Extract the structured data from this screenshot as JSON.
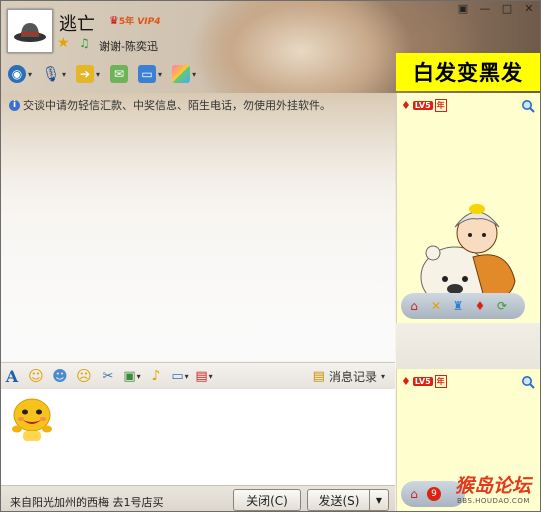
{
  "header": {
    "nickname": "逃亡",
    "vip_badge": "VIP4",
    "vip_years": "5年",
    "signature": "谢谢-陈奕迅",
    "window_buttons": [
      "▣",
      "—",
      "□",
      "✕"
    ]
  },
  "banner": {
    "text": "白发变黑发"
  },
  "chat": {
    "notice": "交谈中请勿轻信汇款、中奖信息、陌生电话，勿使用外挂软件。"
  },
  "input_toolbar": {
    "history_label": "消息记录"
  },
  "bottom": {
    "ad_text": "来自阳光加州的西梅 去1号店买",
    "close_label": "关闭(C)",
    "send_label": "发送(S)"
  },
  "right_panel": {
    "level": "LV5",
    "year_tag": "年",
    "badge_count": "9"
  },
  "watermark": {
    "logo": "猴岛论坛",
    "url": "BBS.HOUDAO.COM"
  },
  "colors": {
    "banner_bg": "#ffff00",
    "panel_bg": "#fffecf",
    "accent_red": "#d21"
  },
  "icons": {
    "toolbar": [
      "video-call-icon",
      "voice-call-icon",
      "file-transfer-icon",
      "sms-icon",
      "screen-share-icon",
      "apps-icon"
    ],
    "input_toolbar": [
      "font-icon",
      "emoticon-icon",
      "magic-emoticon-icon",
      "nudge-icon",
      "screenshot-icon",
      "image-icon",
      "remote-icon",
      "app-box-icon"
    ]
  }
}
